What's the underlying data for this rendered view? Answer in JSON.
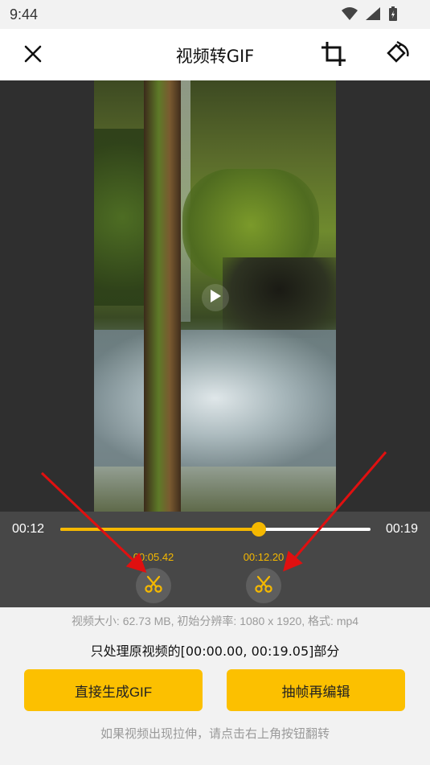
{
  "status": {
    "time": "9:44"
  },
  "header": {
    "title": "视频转GIF"
  },
  "video": {},
  "timeline": {
    "start_time": "00:12",
    "end_time": "00:19",
    "progress": 0.64,
    "cut_start": {
      "label": "00:05.42",
      "position": 0.3
    },
    "cut_end": {
      "label": "00:12.20",
      "position": 0.66
    }
  },
  "info": {
    "details": "视频大小: 62.73 MB, 初始分辨率: 1080 x 1920, 格式: mp4",
    "range": "只处理原视频的[00:00.00, 00:19.05]部分",
    "hint": "如果视频出现拉伸，请点击右上角按钮翻转"
  },
  "actions": {
    "generate_label": "直接生成GIF",
    "extract_label": "抽帧再编辑"
  },
  "colors": {
    "accent": "#fcc000",
    "annotation_arrow": "#e01010"
  }
}
